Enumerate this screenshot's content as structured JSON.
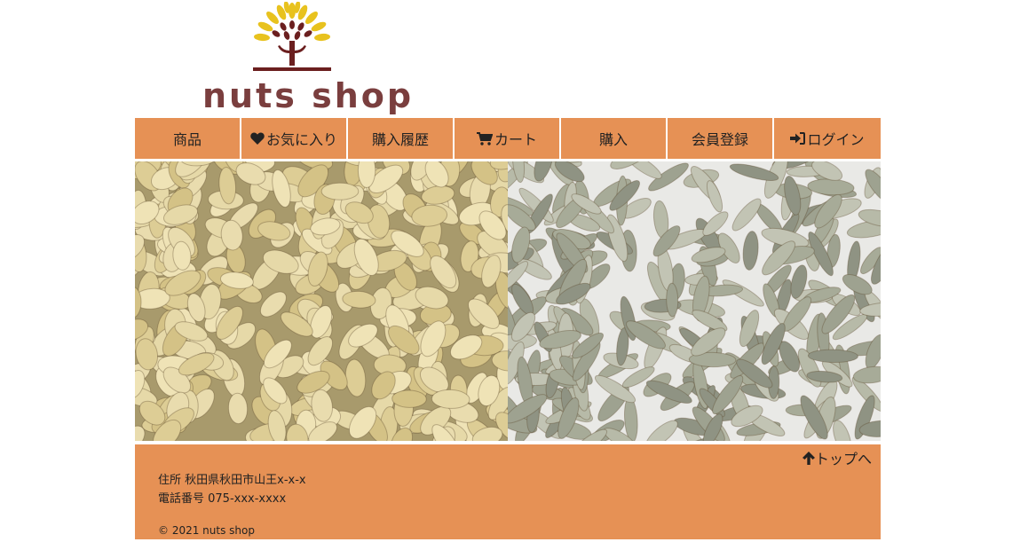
{
  "brand": {
    "name": "nuts shop"
  },
  "nav": {
    "items": [
      {
        "label": "商品",
        "icon": ""
      },
      {
        "label": "お気に入り",
        "icon": "heart-icon"
      },
      {
        "label": "購入履歴",
        "icon": ""
      },
      {
        "label": "カート",
        "icon": "cart-icon"
      },
      {
        "label": "購入",
        "icon": ""
      },
      {
        "label": "会員登録",
        "icon": ""
      },
      {
        "label": "ログイン",
        "icon": "login-icon"
      }
    ]
  },
  "footer": {
    "to_top": "トップへ",
    "address": "住所 秋田県秋田市山王x-x-x",
    "phone": "電話番号 075-xxx-xxxx",
    "copyright": "© 2021 nuts shop"
  },
  "colors": {
    "accent": "#e69155",
    "brand_text": "#7a3e3e",
    "logo_leaf": "#e8c21e"
  }
}
